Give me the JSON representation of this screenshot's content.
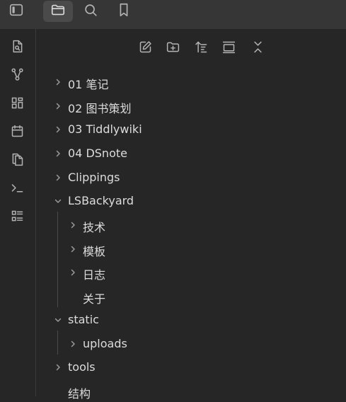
{
  "top_toolbar": {
    "buttons": [
      {
        "name": "toggle-sidebar",
        "icon": "sidebar-toggle-icon",
        "active": false
      },
      {
        "name": "files",
        "icon": "folder-icon",
        "active": true
      },
      {
        "name": "search",
        "icon": "search-icon",
        "active": false
      },
      {
        "name": "bookmarks",
        "icon": "bookmark-icon",
        "active": false
      }
    ]
  },
  "ribbon": {
    "items": [
      {
        "icon": "file-search-icon"
      },
      {
        "icon": "graph-icon"
      },
      {
        "icon": "grid-icon"
      },
      {
        "icon": "calendar-icon"
      },
      {
        "icon": "copy-icon"
      },
      {
        "icon": "terminal-icon"
      },
      {
        "icon": "list-icon"
      }
    ]
  },
  "nav_actions": {
    "items": [
      {
        "icon": "new-note-icon"
      },
      {
        "icon": "new-folder-icon"
      },
      {
        "icon": "sort-icon"
      },
      {
        "icon": "collapse-panel-icon"
      },
      {
        "icon": "collapse-all-icon"
      }
    ]
  },
  "file_tree": {
    "items": [
      {
        "label": "01 笔记",
        "chevron": "right"
      },
      {
        "label": "02 图书策划",
        "chevron": "right"
      },
      {
        "label": "03 Tiddlywiki",
        "chevron": "right"
      },
      {
        "label": "04 DSnote",
        "chevron": "right"
      },
      {
        "label": "Clippings",
        "chevron": "right"
      },
      {
        "label": "LSBackyard",
        "chevron": "down"
      },
      {
        "label": "技术",
        "chevron": "right"
      },
      {
        "label": "模板",
        "chevron": "right"
      },
      {
        "label": "日志",
        "chevron": "right"
      },
      {
        "label": "关于",
        "chevron": "none"
      },
      {
        "label": "static",
        "chevron": "down"
      },
      {
        "label": "uploads",
        "chevron": "right"
      },
      {
        "label": "tools",
        "chevron": "right"
      },
      {
        "label": "结构",
        "chevron": "none"
      }
    ]
  },
  "colors": {
    "background": "#262626",
    "toolbar": "#363636",
    "active_button": "#4a4a4a",
    "icon": "#b4b4b4",
    "text": "#dcdcdc",
    "indent_guide": "#4a4a4a"
  }
}
